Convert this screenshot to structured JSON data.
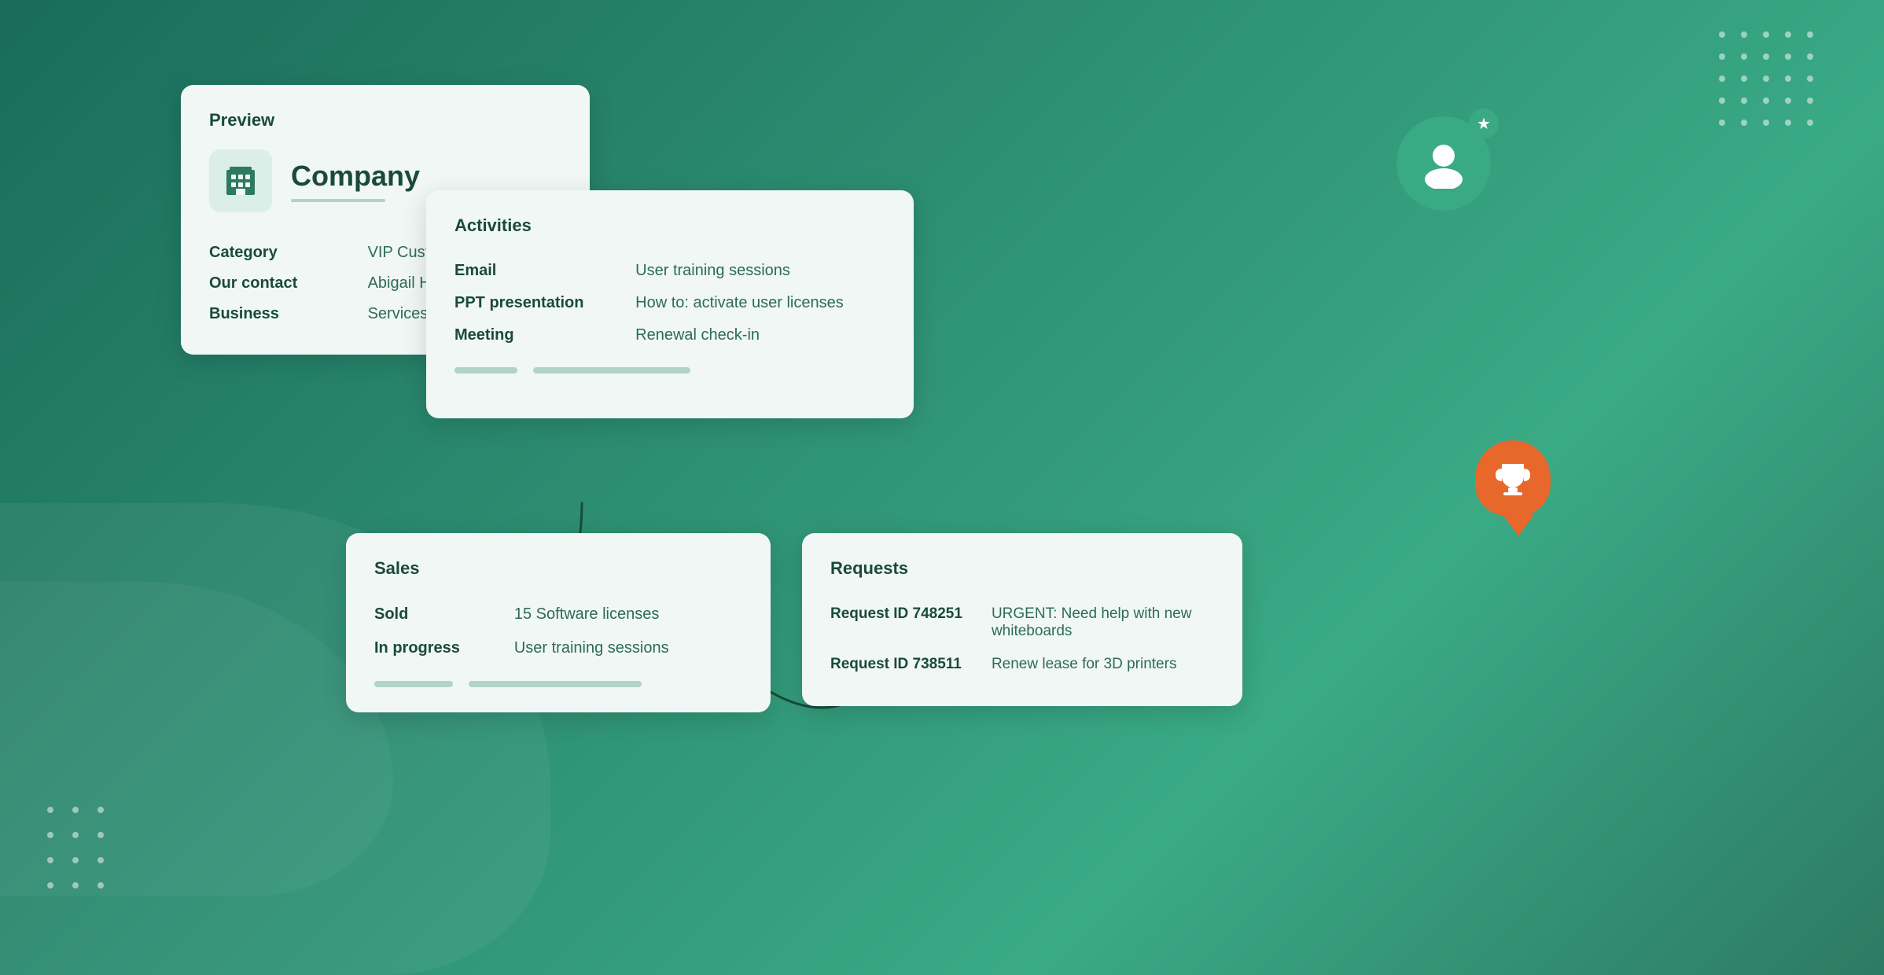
{
  "background": {
    "color_start": "#1a6b5a",
    "color_end": "#2d7a62"
  },
  "preview_card": {
    "title": "Preview",
    "company_name": "Company",
    "company_icon": "🏢",
    "fields": [
      {
        "label": "Category",
        "value": "VIP Customer"
      },
      {
        "label": "Our contact",
        "value": "Abigail Hart"
      },
      {
        "label": "Business",
        "value": "Services"
      }
    ]
  },
  "activities_card": {
    "title": "Activities",
    "rows": [
      {
        "label": "Email",
        "value": "User training sessions"
      },
      {
        "label": "PPT presentation",
        "value": "How to: activate user licenses"
      },
      {
        "label": "Meeting",
        "value": "Renewal check-in"
      }
    ]
  },
  "sales_card": {
    "title": "Sales",
    "rows": [
      {
        "label": "Sold",
        "value": "15 Software licenses"
      },
      {
        "label": "In progress",
        "value": "User training sessions"
      }
    ]
  },
  "requests_card": {
    "title": "Requests",
    "rows": [
      {
        "label": "Request ID 748251",
        "value": "URGENT: Need help with new whiteboards"
      },
      {
        "label": "Request ID 738511",
        "value": "Renew lease for 3D printers"
      }
    ]
  },
  "avatar": {
    "icon": "👤",
    "star": "★"
  },
  "trophy": {
    "icon": "🏆"
  }
}
